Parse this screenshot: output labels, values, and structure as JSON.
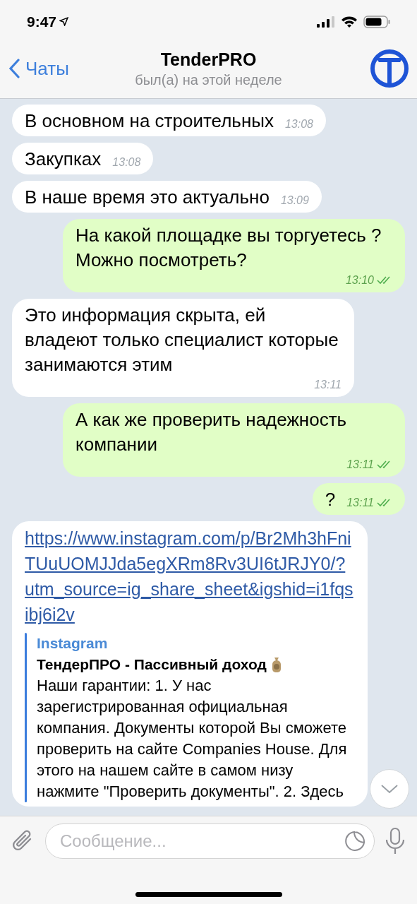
{
  "status_bar": {
    "time": "9:47"
  },
  "header": {
    "back_label": "Чаты",
    "title": "TenderPRO",
    "subtitle": "был(а) на этой неделе"
  },
  "messages": [
    {
      "kind": "incoming",
      "text": "В основном на строительных",
      "time": "13:08"
    },
    {
      "kind": "incoming",
      "text": "Закупках",
      "time": "13:08"
    },
    {
      "kind": "incoming",
      "text": "В наше время это актуально",
      "time": "13:09"
    },
    {
      "kind": "outgoing",
      "text": "На какой площадке вы торгуетесь ? Можно посмотреть?",
      "time": "13:10",
      "read": true
    },
    {
      "kind": "incoming",
      "text": "Это информация скрыта, ей владеют только специалист которые занимаются этим",
      "time": "13:11"
    },
    {
      "kind": "outgoing",
      "text": "А как же проверить надежность компании",
      "time": "13:11",
      "read": true
    },
    {
      "kind": "outgoing",
      "text": "?",
      "time": "13:11",
      "read": true
    },
    {
      "kind": "link",
      "url": "https://www.instagram.com/p/Br2Mh3hFniTUuUOMJJda5egXRm8Rv3UI6tJRJY0/?utm_source=ig_share_sheet&igshid=i1fqsibj6i2v",
      "preview": {
        "site": "Instagram",
        "title": "ТендерПРО - Пассивный доход",
        "description": "Наши гарантии: 1. У нас зарегистрированная официальная компания. Документы которой Вы сможете проверить на сайте Companies House. Для этого на нашем сайте в самом низу нажмите \"Проверить документы\". 2. Здесь"
      }
    }
  ],
  "composer": {
    "placeholder": "Сообщение..."
  }
}
